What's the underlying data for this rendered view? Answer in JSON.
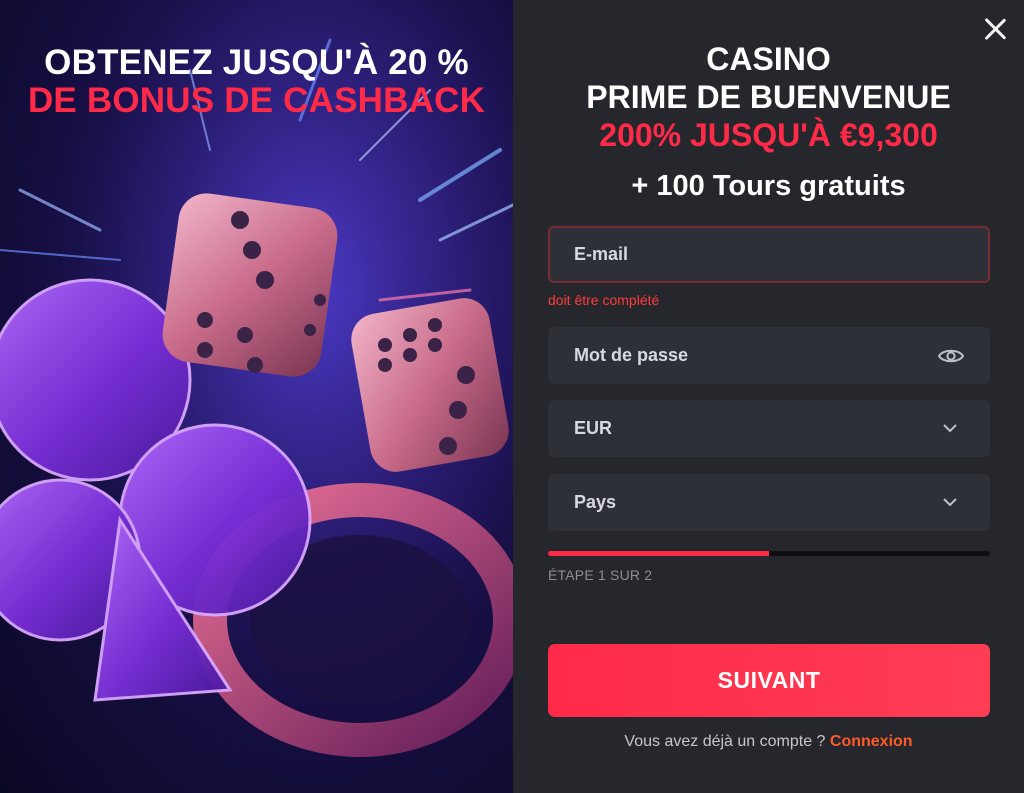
{
  "promo": {
    "line1": "OBTENEZ JUSQU'À 20 %",
    "line2": "DE BONUS DE CASHBACK"
  },
  "modal": {
    "close_icon": "close-icon",
    "title_line1": "CASINO",
    "title_line2": "PRIME DE BUENVENUE",
    "bonus_line": "200% JUSQU'À €9,300",
    "spins_line": "+ 100 Tours gratuits"
  },
  "form": {
    "email": {
      "placeholder": "E-mail",
      "value": "",
      "error": "doit être complété"
    },
    "password": {
      "placeholder": "Mot de passe",
      "icon": "eye-icon"
    },
    "currency": {
      "selected": "EUR",
      "icon": "chevron-down-icon"
    },
    "country": {
      "selected": "Pays",
      "icon": "chevron-down-icon"
    },
    "progress_fraction": 0.5,
    "step_label": "ÉTAPE 1 SUR 2",
    "submit_label": "SUIVANT"
  },
  "footer": {
    "prompt": "Vous avez déjà un compte ?",
    "link_label": "Connexion"
  },
  "colors": {
    "accent": "#ff2a48",
    "panel_bg": "#25272c",
    "field_bg": "#2d3036",
    "link": "#ff5a2a"
  }
}
